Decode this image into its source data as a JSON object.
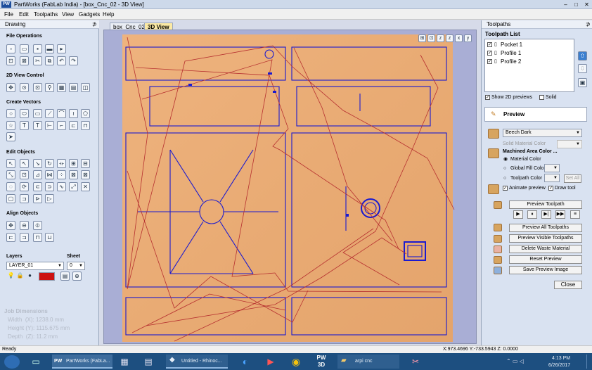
{
  "window": {
    "app_icon": "PW",
    "title": "PartWorks (FabLab India) - [box_Cnc_02 - 3D View]",
    "min": "–",
    "max": "□",
    "close": "✕"
  },
  "menu": [
    "File",
    "Edit",
    "Toolpaths",
    "View",
    "Gadgets",
    "Help"
  ],
  "left": {
    "panel_title": "Drawing",
    "pin": "⊅",
    "sections": {
      "file": "File Operations",
      "view2d": "2D View Control",
      "vectors": "Create Vectors",
      "edit": "Edit Objects",
      "align": "Align Objects"
    },
    "layers_label": "Layers",
    "layer_value": "LAYER_01",
    "sheet_label": "Sheet",
    "sheet_value": "0",
    "job": {
      "title": "Job Dimensions",
      "width": "Width  (X): 1238.0 mm",
      "height": "Height (Y): 1115.675 mm",
      "depth": "Depth  (Z): 11.2 mm"
    }
  },
  "tabs": [
    "box_Cnc_02",
    "3D View"
  ],
  "view_icons": [
    "⊞",
    "⊡",
    "z",
    "z",
    "x",
    "y"
  ],
  "right": {
    "panel_title": "Toolpaths",
    "pin": "⊅",
    "list_title": "Toolpath List",
    "toolpaths": [
      "Pocket 1",
      "Profile 1",
      "Profile 2"
    ],
    "show2d": "Show 2D previews",
    "solid": "Solid",
    "preview_header": "Preview",
    "material": "Beech Dark",
    "solid_color": "Solid Material Color",
    "machined": "Machined Area Color ...",
    "opt_material": "Material Color",
    "opt_global": "Global Fill Color",
    "opt_toolpath": "Toolpath Color",
    "set_all": "Set All",
    "animate": "Animate preview",
    "draw_tool": "Draw tool",
    "buttons": {
      "preview_toolpath": "Preview Toolpath",
      "preview_all": "Preview All Toolpaths",
      "preview_visible": "Preview Visible Toolpaths",
      "delete_waste": "Delete Waste Material",
      "reset": "Reset Preview",
      "save": "Save Preview Image"
    },
    "close": "Close"
  },
  "status": {
    "left": "Ready",
    "coords": "X:973.4696 Y:-733.5943 Z: 0.0000"
  },
  "taskbar": {
    "items": [
      "PartWorks (FabLa...",
      "Untitled - Rhinoc...",
      "arpi cnc"
    ],
    "pw3d": "PW 3D",
    "time": "4:13 PM",
    "date": "6/26/2017"
  },
  "colors": {
    "wood": "#e8ad78",
    "path": "#1a1ad0",
    "travel": "#b63030",
    "viewport_bg": "#a9aed5"
  }
}
